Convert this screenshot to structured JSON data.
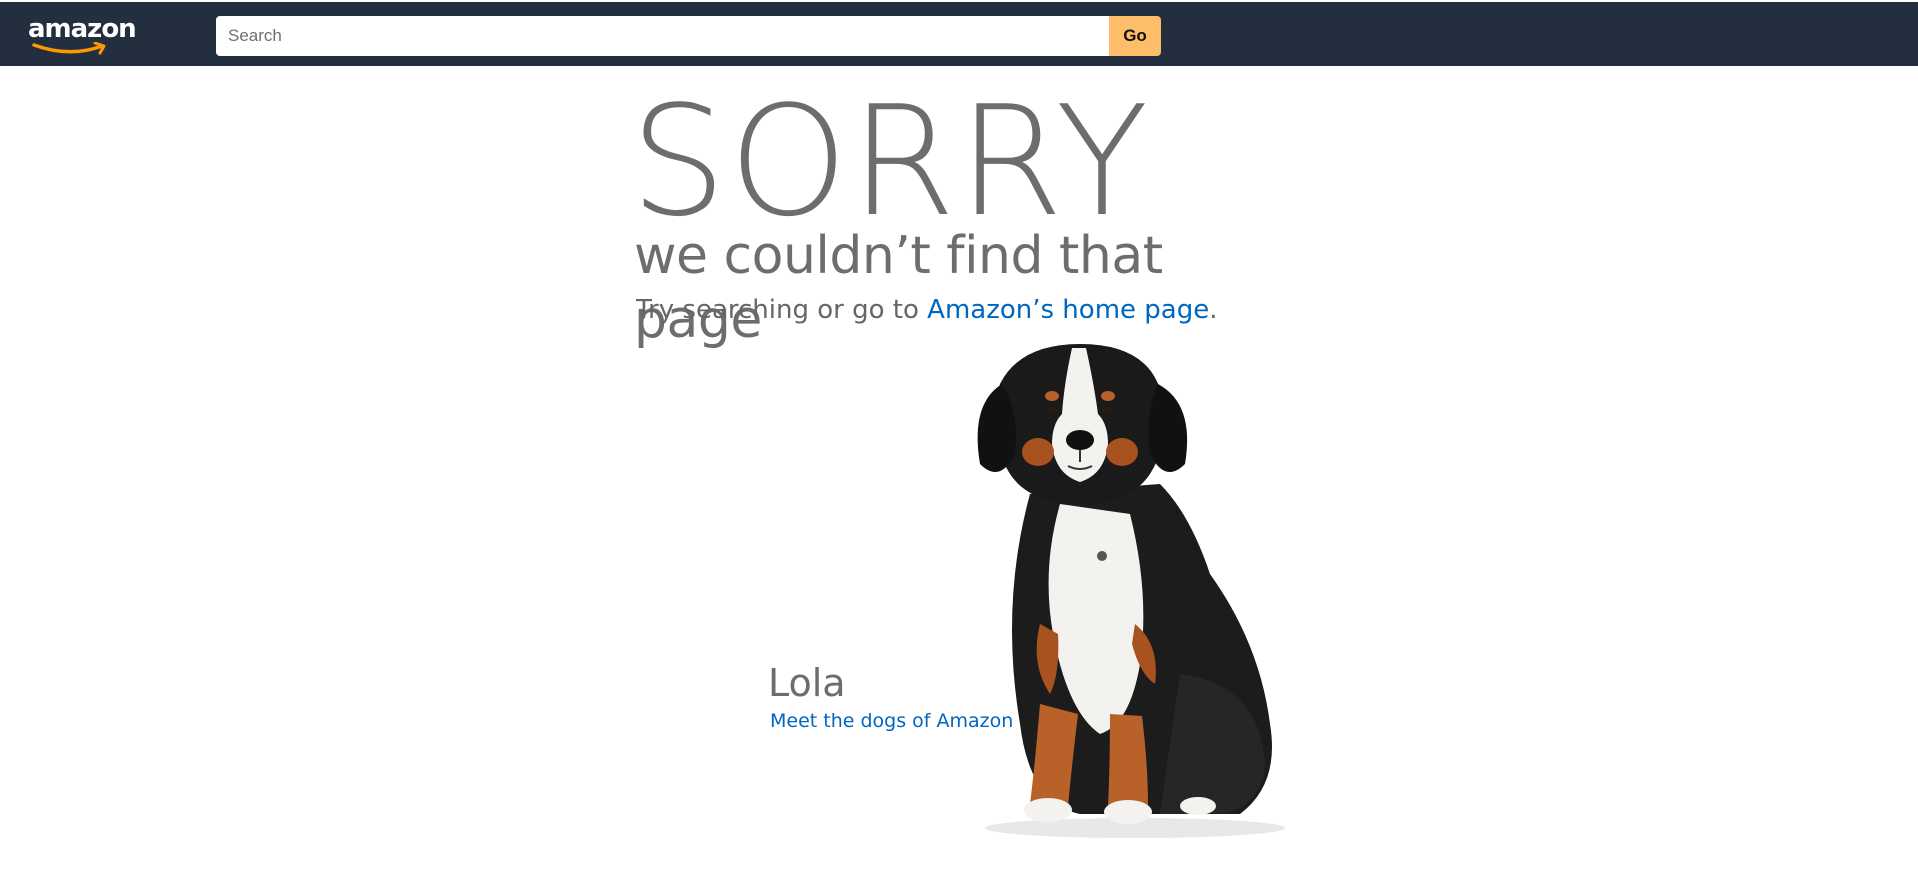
{
  "header": {
    "logo_text": "amazon",
    "search": {
      "placeholder": "Search",
      "value": ""
    },
    "go_label": "Go"
  },
  "main": {
    "heading": "SORRY",
    "subtitle": "we couldn’t find that page",
    "try_prefix": "Try searching or go to ",
    "home_link": "Amazon’s home page",
    "try_suffix": "."
  },
  "dog": {
    "name": "Lola",
    "link": "Meet the dogs of Amazon"
  },
  "colors": {
    "header_bg": "#232f3e",
    "go_button": "#febd69",
    "link": "#0066c0",
    "text_gray": "#6d6d6d",
    "logo_smile": "#ff9900"
  }
}
